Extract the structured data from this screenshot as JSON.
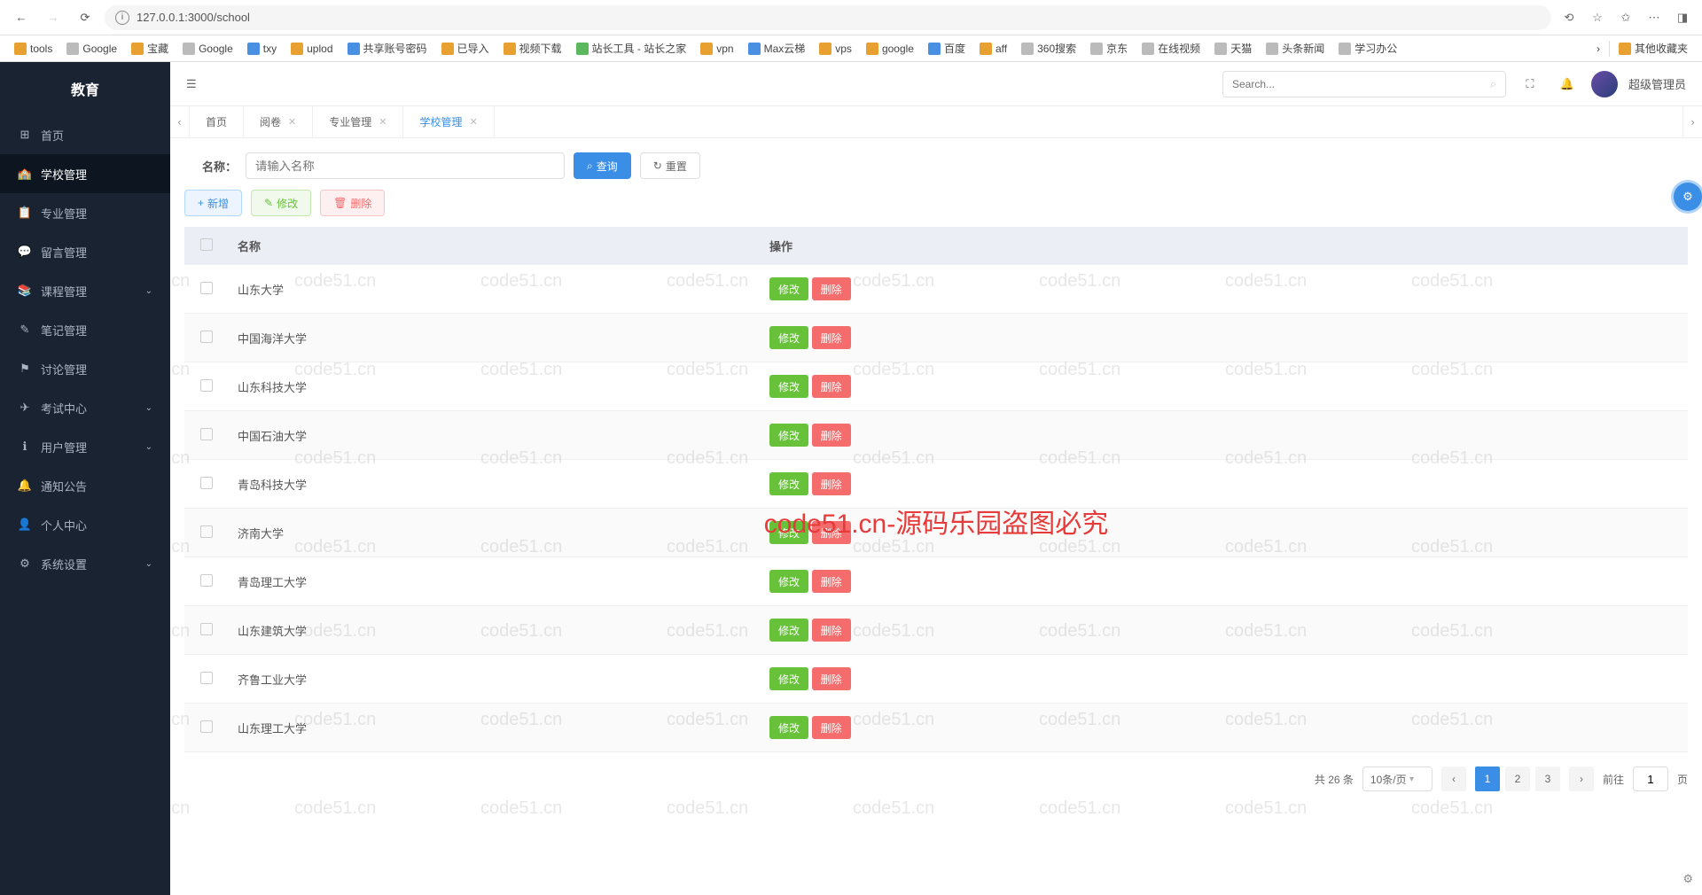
{
  "browser": {
    "url": "127.0.0.1:3000/school",
    "bookmarks": [
      "tools",
      "Google",
      "宝藏",
      "Google",
      "txy",
      "uplod",
      "共享账号密码",
      "已导入",
      "视频下载",
      "站长工具 - 站长之家",
      "vpn",
      "Max云梯",
      "vps",
      "google",
      "百度",
      "aff",
      "360搜索",
      "京东",
      "在线视频",
      "天猫",
      "头条新闻",
      "学习办公"
    ],
    "other_bookmarks": "其他收藏夹"
  },
  "sidebar": {
    "logo": "教育",
    "items": [
      {
        "label": "首页"
      },
      {
        "label": "学校管理"
      },
      {
        "label": "专业管理"
      },
      {
        "label": "留言管理"
      },
      {
        "label": "课程管理",
        "expandable": true
      },
      {
        "label": "笔记管理"
      },
      {
        "label": "讨论管理"
      },
      {
        "label": "考试中心",
        "expandable": true
      },
      {
        "label": "用户管理",
        "expandable": true
      },
      {
        "label": "通知公告"
      },
      {
        "label": "个人中心"
      },
      {
        "label": "系统设置",
        "expandable": true
      }
    ]
  },
  "topbar": {
    "search_placeholder": "Search...",
    "user": "超级管理员"
  },
  "tabs": [
    {
      "label": "首页",
      "closable": false
    },
    {
      "label": "阅卷",
      "closable": true
    },
    {
      "label": "专业管理",
      "closable": true
    },
    {
      "label": "学校管理",
      "closable": true,
      "active": true
    }
  ],
  "filter": {
    "label": "名称：",
    "placeholder": "请输入名称",
    "search_btn": "查询",
    "reset_btn": "重置"
  },
  "actions": {
    "add": "新增",
    "edit": "修改",
    "delete": "删除"
  },
  "table": {
    "headers": {
      "name": "名称",
      "ops": "操作"
    },
    "edit_label": "修改",
    "delete_label": "删除",
    "rows": [
      {
        "name": "山东大学"
      },
      {
        "name": "中国海洋大学"
      },
      {
        "name": "山东科技大学"
      },
      {
        "name": "中国石油大学"
      },
      {
        "name": "青岛科技大学"
      },
      {
        "name": "济南大学"
      },
      {
        "name": "青岛理工大学"
      },
      {
        "name": "山东建筑大学"
      },
      {
        "name": "齐鲁工业大学"
      },
      {
        "name": "山东理工大学"
      }
    ]
  },
  "pagination": {
    "total_text": "共 26 条",
    "page_size": "10条/页",
    "pages": [
      "1",
      "2",
      "3"
    ],
    "goto_label": "前往",
    "goto_value": "1",
    "page_suffix": "页"
  },
  "watermark": {
    "text": "code51.cn",
    "center": "code51.cn-源码乐园盗图必究"
  }
}
